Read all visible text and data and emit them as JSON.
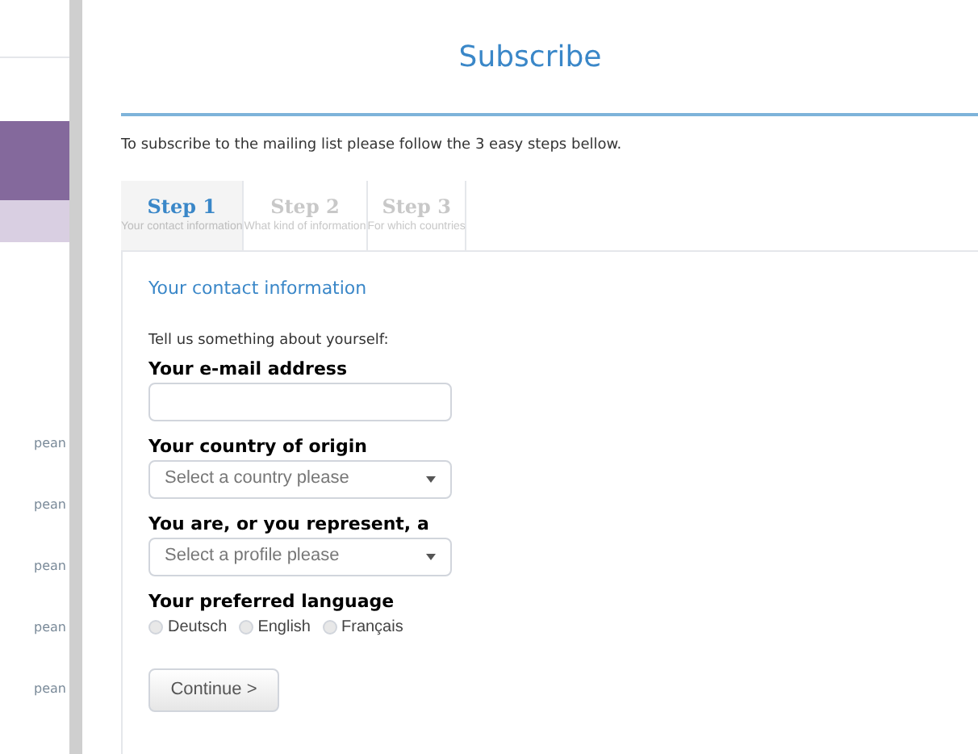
{
  "sidebar": {
    "items": [
      "pean",
      "pean",
      "pean",
      "pean",
      "pean"
    ]
  },
  "title": "Subscribe",
  "intro": "To subscribe to the mailing list please follow the 3 easy steps bellow.",
  "tabs": [
    {
      "label": "Step 1",
      "sublabel": "Your contact information",
      "selected": true
    },
    {
      "label": "Step 2",
      "sublabel": "What kind of information",
      "selected": false
    },
    {
      "label": "Step 3",
      "sublabel": "For which countries",
      "selected": false
    }
  ],
  "form": {
    "heading": "Your contact information",
    "lead": "Tell us something about yourself:",
    "fields": [
      {
        "kind": "text",
        "label": "Your e-mail address"
      },
      {
        "kind": "select",
        "label": "Your country of origin",
        "placeholder": "Select a country please"
      },
      {
        "kind": "select",
        "label": "You are, or you represent, a",
        "placeholder": "Select a profile please"
      },
      {
        "kind": "radio",
        "label": "Your preferred language",
        "options": [
          {
            "label": "Deutsch",
            "selected": false
          },
          {
            "label": "English",
            "selected": false
          },
          {
            "label": "Français",
            "selected": false
          }
        ]
      }
    ],
    "button": "Continue >"
  }
}
